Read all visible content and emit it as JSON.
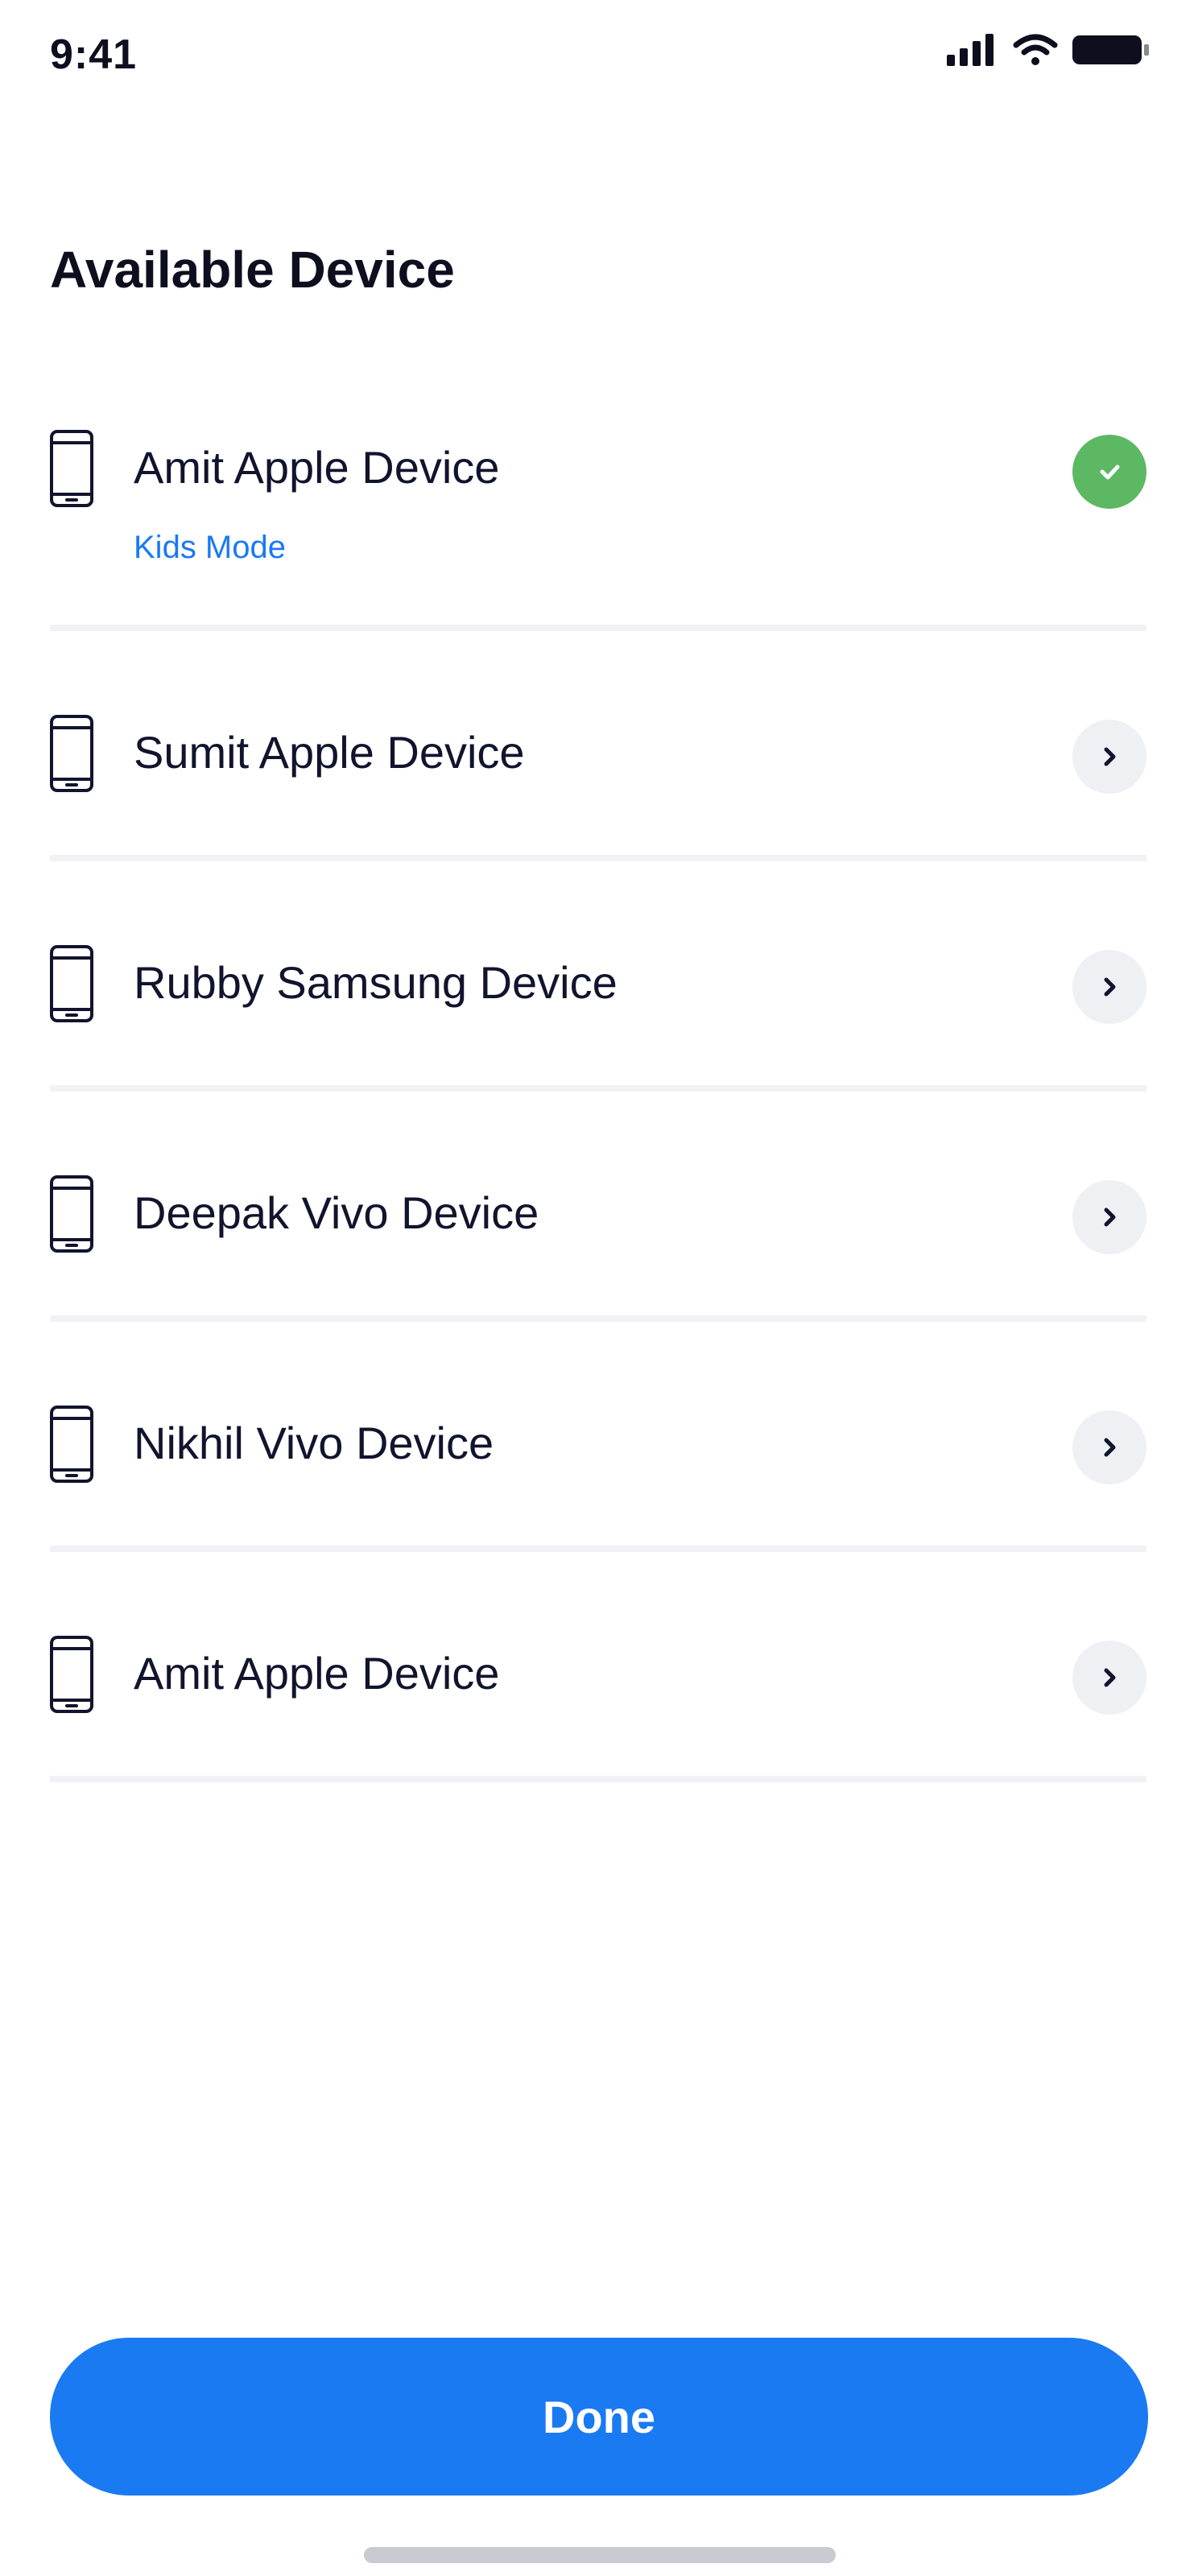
{
  "status_bar": {
    "time": "9:41",
    "icons": [
      "signal-icon",
      "wifi-icon",
      "battery-icon"
    ]
  },
  "page": {
    "title": "Available Device"
  },
  "devices": [
    {
      "name": "Amit Apple Device",
      "mode": "Kids Mode",
      "selected": true,
      "icon": "phone-icon",
      "action_icon": "check-icon"
    },
    {
      "name": "Sumit Apple Device",
      "selected": false,
      "icon": "phone-icon",
      "action_icon": "chevron-right-icon"
    },
    {
      "name": "Rubby Samsung Device",
      "selected": false,
      "icon": "phone-icon",
      "action_icon": "chevron-right-icon"
    },
    {
      "name": "Deepak Vivo Device",
      "selected": false,
      "icon": "phone-icon",
      "action_icon": "chevron-right-icon"
    },
    {
      "name": "Nikhil Vivo Device",
      "selected": false,
      "icon": "phone-icon",
      "action_icon": "chevron-right-icon"
    },
    {
      "name": "Amit Apple Device",
      "selected": false,
      "icon": "phone-icon",
      "action_icon": "chevron-right-icon"
    }
  ],
  "footer": {
    "done_label": "Done"
  },
  "colors": {
    "accent": "#1a7af2",
    "success": "#5cb862",
    "text": "#11142d",
    "divider": "#f1f2f5",
    "chevron_bg": "#eef0f4"
  }
}
